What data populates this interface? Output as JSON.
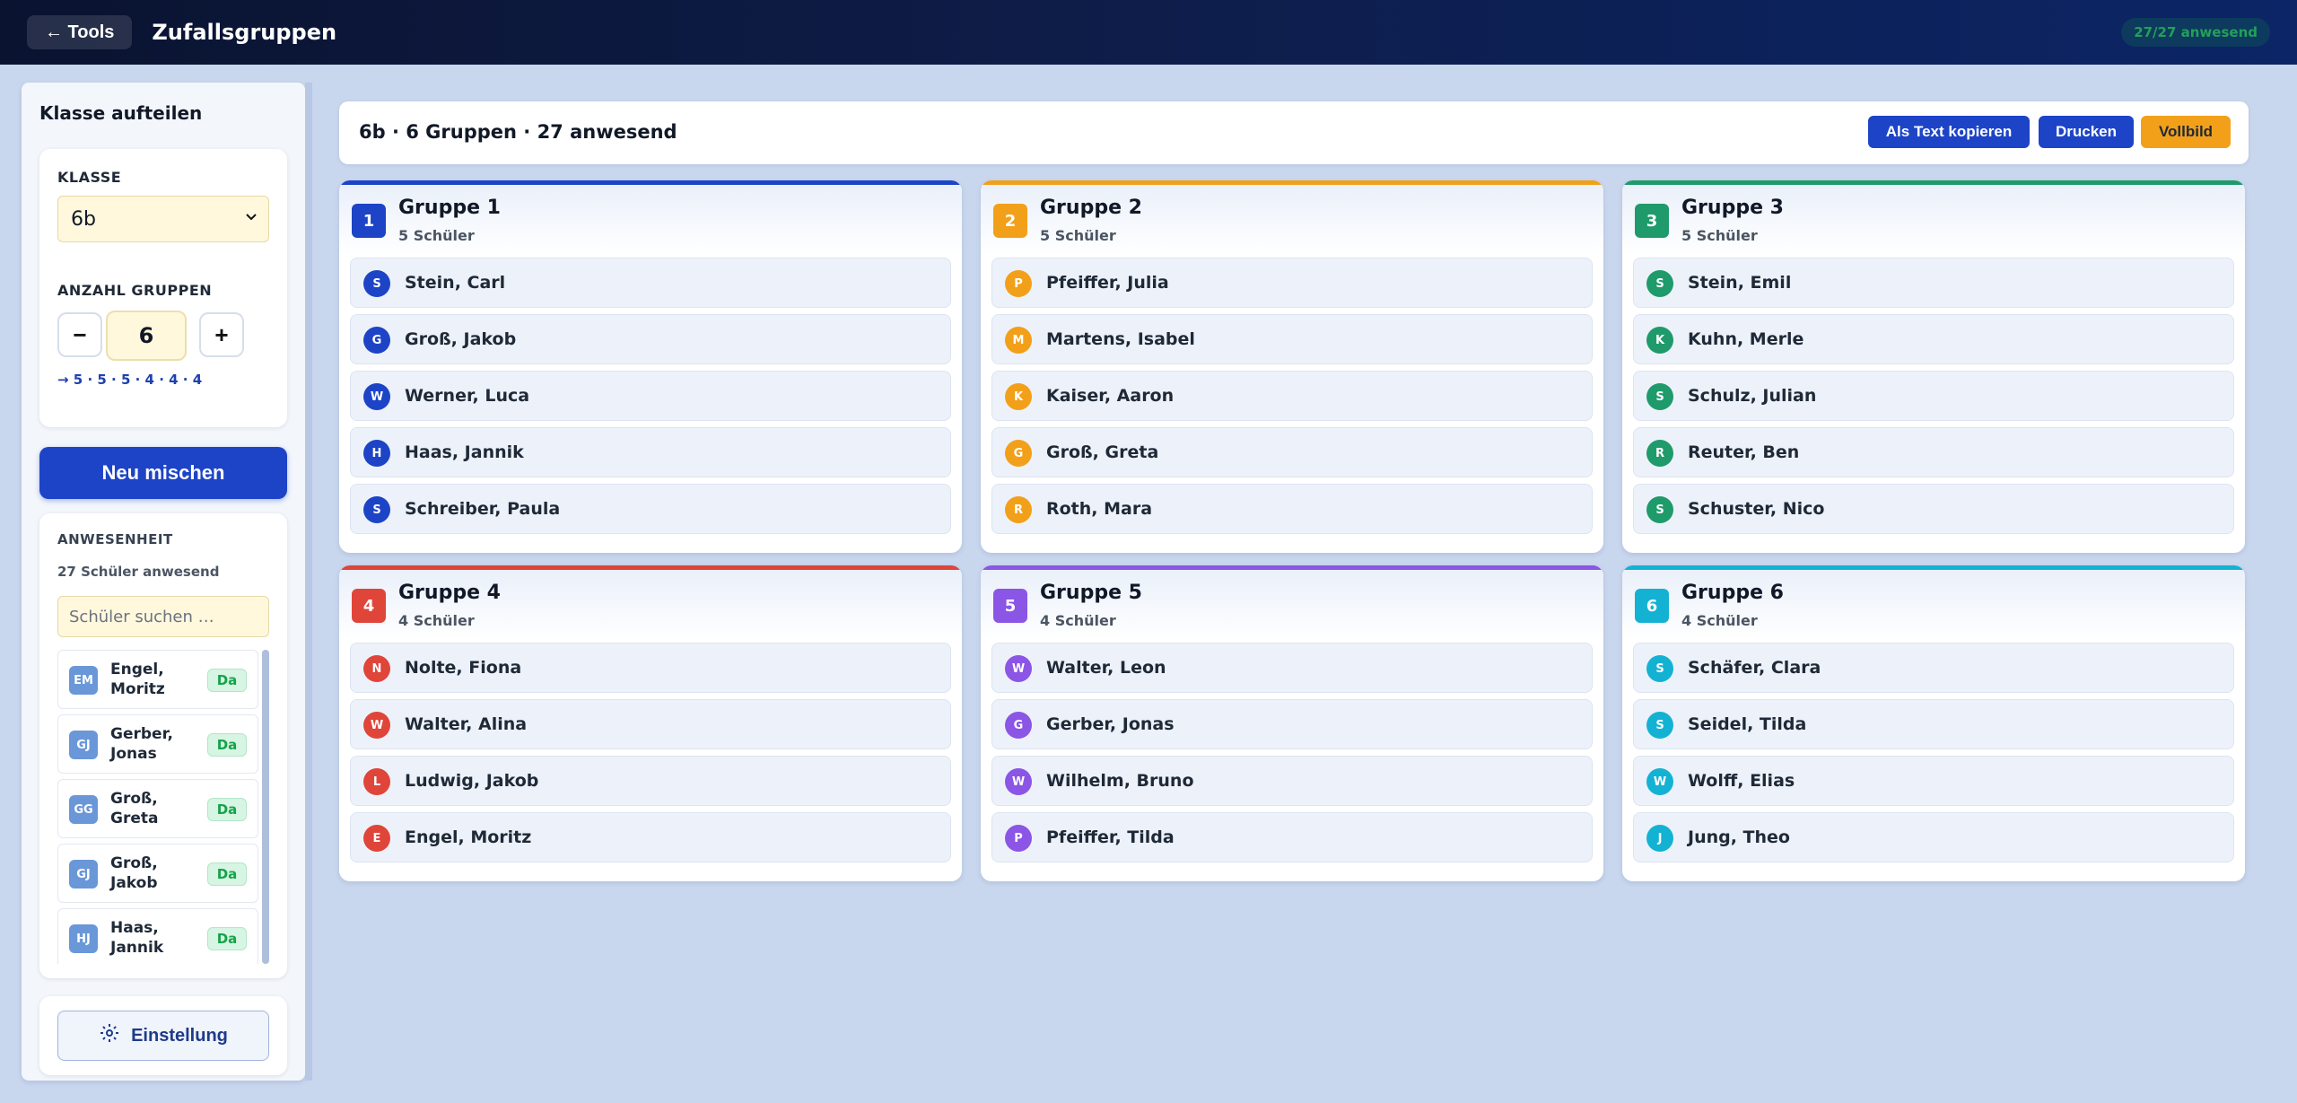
{
  "topbar": {
    "back_label": "← Tools",
    "title": "Zufallsgruppen",
    "present_pill": "27/27 anwesend"
  },
  "sidebar": {
    "title": "Klasse aufteilen",
    "class_label": "KLASSE",
    "class_value": "6b",
    "groups_label": "ANZAHL GRUPPEN",
    "minus": "−",
    "plus": "+",
    "group_count": "6",
    "distribution": "→ 5 · 5 · 5 · 4 · 4 · 4",
    "mix_button": "Neu mischen",
    "attendance_label": "ANWESENHEIT",
    "attendance_status": "27 Schüler anwesend",
    "search_placeholder": "Schüler suchen …",
    "attendance": [
      {
        "initials": "EM",
        "name": "Engel, Moritz",
        "status": "Da"
      },
      {
        "initials": "GJ",
        "name": "Gerber, Jonas",
        "status": "Da"
      },
      {
        "initials": "GG",
        "name": "Groß, Greta",
        "status": "Da"
      },
      {
        "initials": "GJ",
        "name": "Groß, Jakob",
        "status": "Da"
      },
      {
        "initials": "HJ",
        "name": "Haas, Jannik",
        "status": "Da"
      }
    ],
    "settings_label": "Einstellung"
  },
  "header": {
    "title": "6b · 6 Gruppen · 27 anwesend",
    "copy_label": "Als Text kopieren",
    "print_label": "Drucken",
    "fullscreen_label": "Vollbild"
  },
  "colors": {
    "primary": "#1d44c7",
    "accent": "#f2a01a",
    "g1": "#1d44c7",
    "g2": "#f2a01a",
    "g3": "#1f9a6b",
    "g4": "#e0453a",
    "g5": "#8b55e6",
    "g6": "#13b2d3"
  },
  "groups": [
    {
      "number": "1",
      "name": "Gruppe 1",
      "count": "5 Schüler",
      "members": [
        {
          "initial": "S",
          "name": "Stein, Carl"
        },
        {
          "initial": "G",
          "name": "Groß, Jakob"
        },
        {
          "initial": "W",
          "name": "Werner, Luca"
        },
        {
          "initial": "H",
          "name": "Haas, Jannik"
        },
        {
          "initial": "S",
          "name": "Schreiber, Paula"
        }
      ]
    },
    {
      "number": "2",
      "name": "Gruppe 2",
      "count": "5 Schüler",
      "members": [
        {
          "initial": "P",
          "name": "Pfeiffer, Julia"
        },
        {
          "initial": "M",
          "name": "Martens, Isabel"
        },
        {
          "initial": "K",
          "name": "Kaiser, Aaron"
        },
        {
          "initial": "G",
          "name": "Groß, Greta"
        },
        {
          "initial": "R",
          "name": "Roth, Mara"
        }
      ]
    },
    {
      "number": "3",
      "name": "Gruppe 3",
      "count": "5 Schüler",
      "members": [
        {
          "initial": "S",
          "name": "Stein, Emil"
        },
        {
          "initial": "K",
          "name": "Kuhn, Merle"
        },
        {
          "initial": "S",
          "name": "Schulz, Julian"
        },
        {
          "initial": "R",
          "name": "Reuter, Ben"
        },
        {
          "initial": "S",
          "name": "Schuster, Nico"
        }
      ]
    },
    {
      "number": "4",
      "name": "Gruppe 4",
      "count": "4 Schüler",
      "members": [
        {
          "initial": "N",
          "name": "Nolte, Fiona"
        },
        {
          "initial": "W",
          "name": "Walter, Alina"
        },
        {
          "initial": "L",
          "name": "Ludwig, Jakob"
        },
        {
          "initial": "E",
          "name": "Engel, Moritz"
        }
      ]
    },
    {
      "number": "5",
      "name": "Gruppe 5",
      "count": "4 Schüler",
      "members": [
        {
          "initial": "W",
          "name": "Walter, Leon"
        },
        {
          "initial": "G",
          "name": "Gerber, Jonas"
        },
        {
          "initial": "W",
          "name": "Wilhelm, Bruno"
        },
        {
          "initial": "P",
          "name": "Pfeiffer, Tilda"
        }
      ]
    },
    {
      "number": "6",
      "name": "Gruppe 6",
      "count": "4 Schüler",
      "members": [
        {
          "initial": "S",
          "name": "Schäfer, Clara"
        },
        {
          "initial": "S",
          "name": "Seidel, Tilda"
        },
        {
          "initial": "W",
          "name": "Wolff, Elias"
        },
        {
          "initial": "J",
          "name": "Jung, Theo"
        }
      ]
    }
  ]
}
